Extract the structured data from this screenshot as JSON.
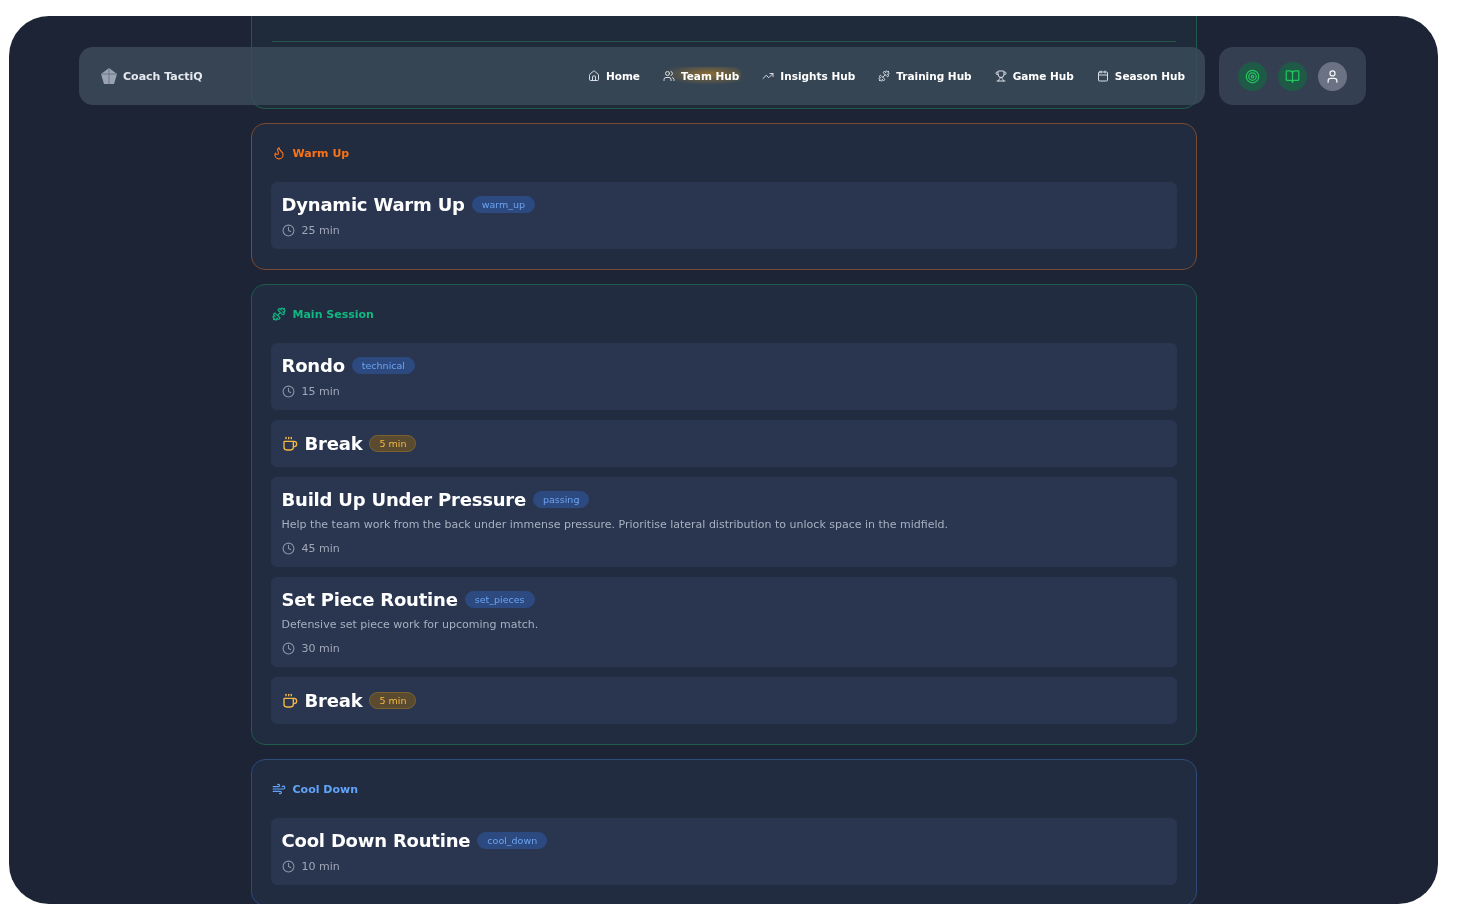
{
  "brand": "Coach TactiQ",
  "nav": [
    {
      "label": "Home",
      "selected": false
    },
    {
      "label": "Team Hub",
      "selected": true
    },
    {
      "label": "Insights Hub",
      "selected": false
    },
    {
      "label": "Training Hub",
      "selected": false
    },
    {
      "label": "Game Hub",
      "selected": false
    },
    {
      "label": "Season Hub",
      "selected": false
    }
  ],
  "actions": [
    {
      "kind": "accent"
    },
    {
      "kind": "accent"
    },
    {
      "kind": "plain"
    }
  ],
  "sections": [
    {
      "title": "Warm Up",
      "kind": "warm_up",
      "items": [
        {
          "kind": "drill",
          "title": "Dynamic Warm Up",
          "tag": "warm_up",
          "duration": "25 min"
        }
      ]
    },
    {
      "title": "Main Session",
      "kind": "main",
      "items": [
        {
          "kind": "drill",
          "title": "Rondo",
          "tag": "technical",
          "duration": "15 min"
        },
        {
          "kind": "break",
          "title": "Break",
          "duration": "5 min"
        },
        {
          "kind": "drill",
          "title": "Build Up Under Pressure",
          "tag": "passing",
          "description": "Help the team work from the back under immense pressure. Prioritise lateral distribution to unlock space in the midfield.",
          "duration": "45 min"
        },
        {
          "kind": "drill",
          "title": "Set Piece Routine",
          "tag": "set_pieces",
          "description": "Defensive set piece work for upcoming match.",
          "duration": "30 min"
        },
        {
          "kind": "break",
          "title": "Break",
          "duration": "5 min"
        }
      ]
    },
    {
      "title": "Cool Down",
      "kind": "cool_down",
      "items": [
        {
          "kind": "drill",
          "title": "Cool Down Routine",
          "tag": "cool_down",
          "duration": "10 min"
        }
      ]
    }
  ]
}
